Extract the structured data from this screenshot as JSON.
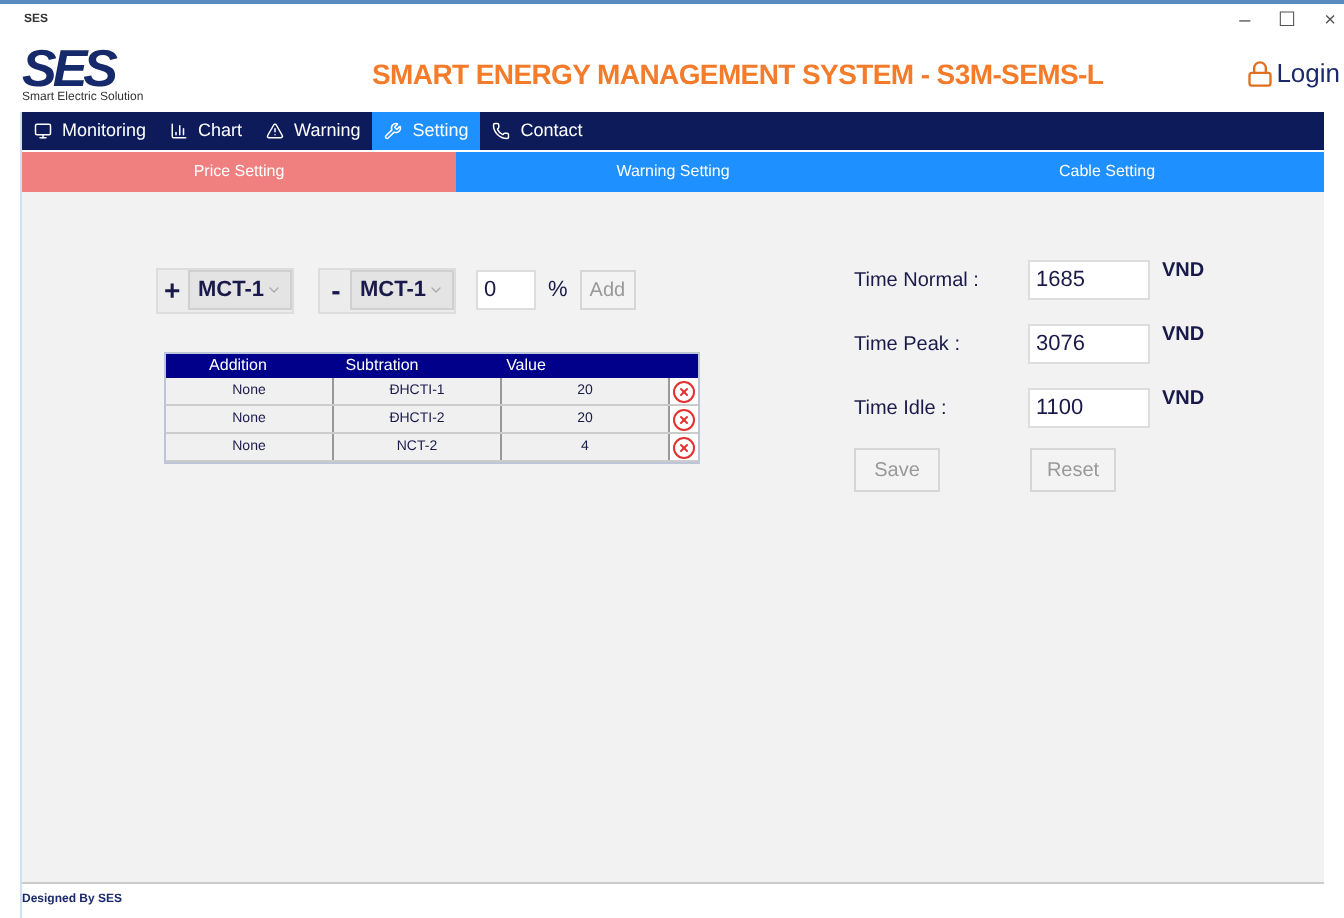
{
  "window": {
    "title": "SES",
    "controls": [
      "–",
      "☐",
      "×"
    ]
  },
  "header": {
    "logo": "SES",
    "logo_caption": "Smart Electric Solution",
    "title": "SMART ENERGY MANAGEMENT SYSTEM - S3M-SEMS-L",
    "login": "Login"
  },
  "nav": [
    {
      "label": "Monitoring",
      "kind": "monitor",
      "selected": false
    },
    {
      "label": "Chart",
      "kind": "chart",
      "selected": false
    },
    {
      "label": "Warning",
      "kind": "warning",
      "selected": false
    },
    {
      "label": "Setting",
      "kind": "setting",
      "selected": true
    },
    {
      "label": "Contact",
      "kind": "contact",
      "selected": false
    }
  ],
  "subtabs": [
    {
      "label": "Price Setting",
      "selected": true
    },
    {
      "label": "Warning Setting",
      "selected": false
    },
    {
      "label": "Cable Setting",
      "selected": false
    }
  ],
  "formula": {
    "plus": "+",
    "plus_value": "MCT-1",
    "minus": "-",
    "minus_value": "MCT-1",
    "percent_value": "0",
    "percent": "%",
    "add": "Add"
  },
  "table": {
    "columns": [
      "Addition",
      "Subtration",
      "Value"
    ],
    "rows": [
      [
        "None",
        "ĐHCTI-1",
        "20"
      ],
      [
        "None",
        "ĐHCTI-2",
        "20"
      ],
      [
        "None",
        "NCT-2",
        "4"
      ]
    ]
  },
  "prices": [
    {
      "label": "Time Normal :",
      "value": "1685",
      "unit": "VND"
    },
    {
      "label": "Time Peak :",
      "value": "3076",
      "unit": "VND"
    },
    {
      "label": "Time Idle :",
      "value": "1100",
      "unit": "VND"
    }
  ],
  "buttons": [
    "Save",
    "Reset"
  ],
  "status_bar": "Designed By SES"
}
